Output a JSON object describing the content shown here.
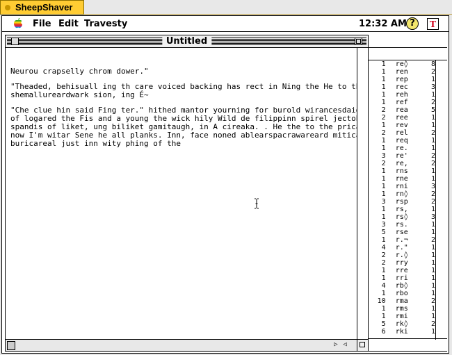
{
  "host": {
    "tab_label": "SheepShaver"
  },
  "menubar": {
    "items": [
      {
        "label": "File"
      },
      {
        "label": "Edit"
      },
      {
        "label": "Travesty"
      }
    ],
    "clock": "12:32 AM",
    "help_glyph": "?",
    "app_glyph": "T"
  },
  "window": {
    "title": "Untitled",
    "paragraphs": [
      "Neurou crapselly chrom dower.\"",
      "\"Theaded, behisuall ing th care voiced backing has rect in Ning the He to the blust\nshemallureardwark sion, ing É~",
      "\"Che clue hin said Fing ter.\" hithed mantor yourning for burold wirancesdaid's go\nof logared the Fis and a young the wick hily Wild de filippinn spirel jectobace\nspandis of liket, ung biliket gamitaugh, in A cireaka. . He the to the pricand by\nnow I'm witar Sene he all planks. Inn, face noned ablearspacrawareard miticares,\nburicareal just inn wity phing of the"
    ]
  },
  "panel": {
    "rows": [
      {
        "count": "1",
        "key": "re◊",
        "num": "8"
      },
      {
        "count": "1",
        "key": "ren",
        "num": "2"
      },
      {
        "count": "1",
        "key": "rep",
        "num": "1"
      },
      {
        "count": "1",
        "key": "rec",
        "num": "3"
      },
      {
        "count": "1",
        "key": "reh",
        "num": "1"
      },
      {
        "count": "1",
        "key": "ref",
        "num": "2"
      },
      {
        "count": "2",
        "key": "rea",
        "num": "5"
      },
      {
        "count": "2",
        "key": "ree",
        "num": "1"
      },
      {
        "count": "1",
        "key": "rev",
        "num": "1"
      },
      {
        "count": "2",
        "key": "rel",
        "num": "2"
      },
      {
        "count": "1",
        "key": "req",
        "num": "1"
      },
      {
        "count": "1",
        "key": "re.",
        "num": "1"
      },
      {
        "count": "3",
        "key": "re'",
        "num": "2"
      },
      {
        "count": "2",
        "key": "re,",
        "num": "2"
      },
      {
        "count": "1",
        "key": "rns",
        "num": "1"
      },
      {
        "count": "1",
        "key": "rne",
        "num": "1"
      },
      {
        "count": "1",
        "key": "rni",
        "num": "3"
      },
      {
        "count": "1",
        "key": "rn◊",
        "num": "2"
      },
      {
        "count": "3",
        "key": "rsp",
        "num": "2"
      },
      {
        "count": "1",
        "key": "rs,",
        "num": "1"
      },
      {
        "count": "1",
        "key": "rs◊",
        "num": "3"
      },
      {
        "count": "3",
        "key": "rs.",
        "num": "1"
      },
      {
        "count": "5",
        "key": "rse",
        "num": "1"
      },
      {
        "count": "1",
        "key": "r.¬",
        "num": "2"
      },
      {
        "count": "4",
        "key": "r.\"",
        "num": "1"
      },
      {
        "count": "2",
        "key": "r.◊",
        "num": "1"
      },
      {
        "count": "2",
        "key": "rry",
        "num": "1"
      },
      {
        "count": "1",
        "key": "rre",
        "num": "1"
      },
      {
        "count": "1",
        "key": "rri",
        "num": "1"
      },
      {
        "count": "4",
        "key": "rb◊",
        "num": "1"
      },
      {
        "count": "1",
        "key": "rbo",
        "num": "1"
      },
      {
        "count": "10",
        "key": "rma",
        "num": "2"
      },
      {
        "count": "1",
        "key": "rms",
        "num": "1"
      },
      {
        "count": "1",
        "key": "rmi",
        "num": "1"
      },
      {
        "count": "5",
        "key": "rk◊",
        "num": "2"
      },
      {
        "count": "6",
        "key": "rki",
        "num": "1"
      }
    ]
  },
  "colors": {
    "host_tab": "#ffcc33",
    "help_icon": "#f2e66c",
    "app_icon_letter": "#d0001a"
  }
}
